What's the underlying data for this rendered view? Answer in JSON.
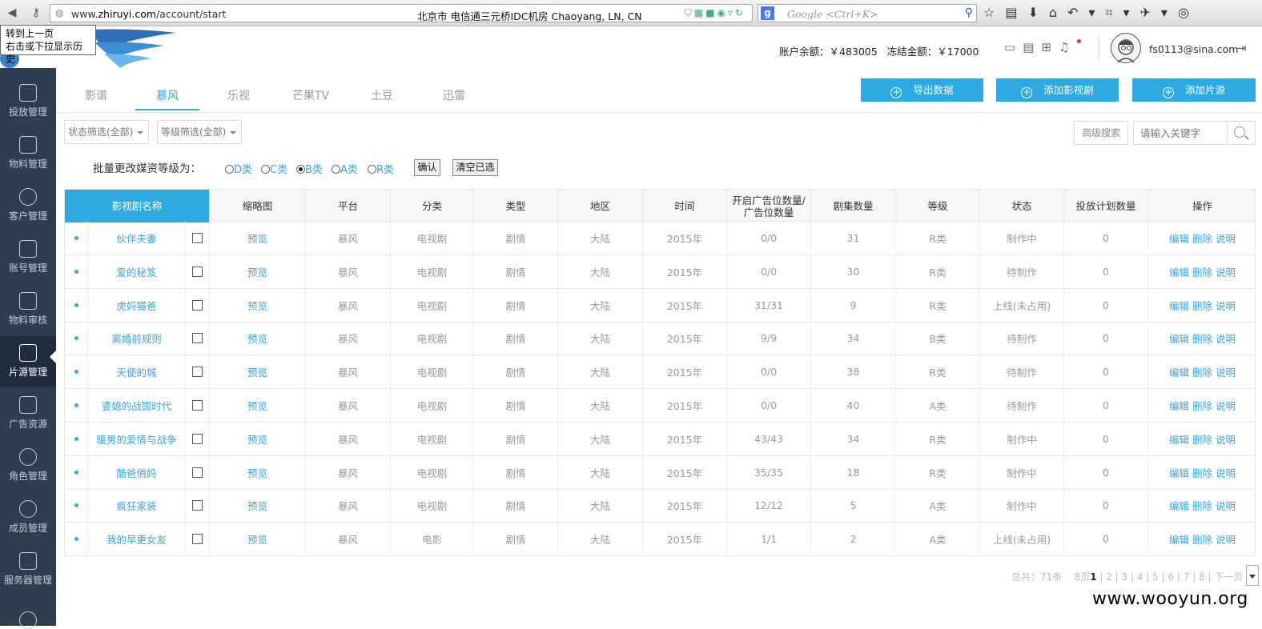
{
  "browser": {
    "url_prefix": "www.",
    "url_host": "zhiruyi.com",
    "url_path": "/account/start",
    "location": "北京市 电信通三元桥IDC机房   Chaoyang, LN, CN",
    "search_placeholder": "Google <Ctrl+K>",
    "tooltip_line1": "转到上一页",
    "tooltip_line2": "右击或下拉显示历史"
  },
  "header": {
    "balance": "账户余额：￥483005",
    "frozen": "冻结金额：￥17000",
    "user": "fs0113@sina.com"
  },
  "sidebar": {
    "items": [
      {
        "label": "投放管理"
      },
      {
        "label": "物料管理"
      },
      {
        "label": "客户管理"
      },
      {
        "label": "账号管理"
      },
      {
        "label": "物料审核"
      },
      {
        "label": "片源管理"
      },
      {
        "label": "广告资源"
      },
      {
        "label": "角色管理"
      },
      {
        "label": "成员管理"
      },
      {
        "label": "服务器管理"
      }
    ]
  },
  "tabs": [
    "影谱",
    "暴风",
    "乐视",
    "芒果TV",
    "土豆",
    "迅雷"
  ],
  "actions": {
    "export": "导出数据",
    "add_rule": "添加影视剧",
    "add_source": "添加片源"
  },
  "filters": {
    "status": "状态筛选(全部)",
    "level": "等级筛选(全部)",
    "advanced": "高级搜索",
    "keyword_placeholder": "请输入关键字"
  },
  "batch": {
    "label": "批量更改媒资等级为：",
    "options": [
      "D类",
      "C类",
      "B类",
      "A类",
      "R类"
    ],
    "confirm": "确认",
    "clear": "清空已选"
  },
  "table": {
    "headers": [
      "影视剧名称",
      "缩略图",
      "平台",
      "分类",
      "类型",
      "地区",
      "时间",
      "开启广告位数量/广告位数量",
      "剧集数量",
      "等级",
      "状态",
      "投放计划数量",
      "操作"
    ],
    "preview": "预览",
    "ops": [
      "编辑",
      "删除",
      "说明"
    ],
    "rows": [
      {
        "name": "伙伴夫妻",
        "platform": "暴风",
        "category": "电视剧",
        "genre": "剧情",
        "region": "大陆",
        "year": "2015年",
        "slots": "0/0",
        "episodes": "31",
        "level": "R类",
        "status": "制作中",
        "plans": "0"
      },
      {
        "name": "爱的秘笈",
        "platform": "暴风",
        "category": "电视剧",
        "genre": "剧情",
        "region": "大陆",
        "year": "2015年",
        "slots": "0/0",
        "episodes": "30",
        "level": "R类",
        "status": "待制作",
        "plans": "0"
      },
      {
        "name": "虎妈猫爸",
        "platform": "暴风",
        "category": "电视剧",
        "genre": "剧情",
        "region": "大陆",
        "year": "2015年",
        "slots": "31/31",
        "episodes": "9",
        "level": "R类",
        "status": "上线(未占用)",
        "plans": "0"
      },
      {
        "name": "离婚前规则",
        "platform": "暴风",
        "category": "电视剧",
        "genre": "剧情",
        "region": "大陆",
        "year": "2015年",
        "slots": "9/9",
        "episodes": "34",
        "level": "B类",
        "status": "待制作",
        "plans": "0"
      },
      {
        "name": "天使的城",
        "platform": "暴风",
        "category": "电视剧",
        "genre": "剧情",
        "region": "大陆",
        "year": "2015年",
        "slots": "0/0",
        "episodes": "38",
        "level": "R类",
        "status": "待制作",
        "plans": "0"
      },
      {
        "name": "婆媳的战国时代",
        "platform": "暴风",
        "category": "电视剧",
        "genre": "剧情",
        "region": "大陆",
        "year": "2015年",
        "slots": "0/0",
        "episodes": "40",
        "level": "A类",
        "status": "待制作",
        "plans": "0"
      },
      {
        "name": "暖男的爱情与战争",
        "platform": "暴风",
        "category": "电视剧",
        "genre": "剧情",
        "region": "大陆",
        "year": "2015年",
        "slots": "43/43",
        "episodes": "34",
        "level": "R类",
        "status": "制作中",
        "plans": "0"
      },
      {
        "name": "酷爸俏妈",
        "platform": "暴风",
        "category": "电视剧",
        "genre": "剧情",
        "region": "大陆",
        "year": "2015年",
        "slots": "35/35",
        "episodes": "18",
        "level": "R类",
        "status": "制作中",
        "plans": "0"
      },
      {
        "name": "疯狂家装",
        "platform": "暴风",
        "category": "电视剧",
        "genre": "剧情",
        "region": "大陆",
        "year": "2015年",
        "slots": "12/12",
        "episodes": "5",
        "level": "A类",
        "status": "制作中",
        "plans": "0"
      },
      {
        "name": "我的早更女友",
        "platform": "暴风",
        "category": "电影",
        "genre": "剧情",
        "region": "大陆",
        "year": "2015年",
        "slots": "1/1",
        "episodes": "2",
        "level": "A类",
        "status": "上线(未占用)",
        "plans": "0"
      }
    ]
  },
  "pager": {
    "total": "总共：71条",
    "pages": "8页",
    "current": "1",
    "others": "| 2 | 3 | 4 | 5 | 6 | 7 | 8 | 下一页",
    "select": "1"
  },
  "watermark": "www.wooyun.org",
  "colors": {
    "accent": "#2eaae1",
    "sidebar": "#2c3e50"
  }
}
